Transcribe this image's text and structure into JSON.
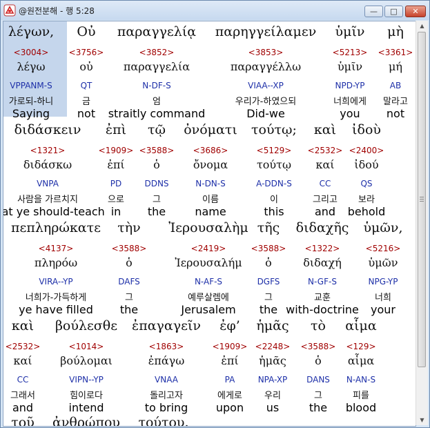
{
  "window": {
    "title": "@원전분해 - 행 5:28",
    "buttons": {
      "minimize": "—",
      "maximize": "□",
      "close": "✕"
    }
  },
  "rows": [
    {
      "words": [
        {
          "greek": "λέγων,",
          "strong": "<3004>",
          "lemma": "λέγω",
          "parse": "VPPANM-S",
          "korean": "가로되-하니",
          "english": "Saying"
        },
        {
          "greek": "Οὐ",
          "strong": "<3756>",
          "lemma": "οὐ",
          "parse": "QT",
          "korean": "금",
          "english": "not"
        },
        {
          "greek": "παραγγελίᾳ",
          "strong": "<3852>",
          "lemma": "παραγγελία",
          "parse": "N-DF-S",
          "korean": "엄",
          "english": "straitly command"
        },
        {
          "greek": "παρηγγείλαμεν",
          "strong": "<3853>",
          "lemma": "παραγγέλλω",
          "parse": "VIAA--XP",
          "korean": "우리가-하였으되",
          "english": "Did-we"
        },
        {
          "greek": "ὑμῖν",
          "strong": "<5213>",
          "lemma": "ὑμῖν",
          "parse": "NPD-YP",
          "korean": "너희에게",
          "english": "you"
        },
        {
          "greek": "μὴ",
          "strong": "<3361>",
          "lemma": "μή",
          "parse": "AB",
          "korean": "말라고",
          "english": "not"
        }
      ]
    },
    {
      "words": [
        {
          "greek": "διδάσκειν",
          "strong": "<1321>",
          "lemma": "διδάσκω",
          "parse": "VNPA",
          "korean": "사람을 가르치지",
          "english": "that ye should-teach"
        },
        {
          "greek": "ἐπὶ",
          "strong": "<1909>",
          "lemma": "ἐπί",
          "parse": "PD",
          "korean": "으로",
          "english": "in"
        },
        {
          "greek": "τῷ",
          "strong": "<3588>",
          "lemma": "ὁ",
          "parse": "DDNS",
          "korean": "그",
          "english": "the"
        },
        {
          "greek": "ὀνόματι",
          "strong": "<3686>",
          "lemma": "ὄνομα",
          "parse": "N-DN-S",
          "korean": "이름",
          "english": "name"
        },
        {
          "greek": "τούτῳ;",
          "strong": "<5129>",
          "lemma": "τούτῳ",
          "parse": "A-DDN-S",
          "korean": "이",
          "english": "this"
        },
        {
          "greek": "καὶ",
          "strong": "<2532>",
          "lemma": "καί",
          "parse": "CC",
          "korean": "그리고",
          "english": "and"
        },
        {
          "greek": "ἰδοὺ",
          "strong": "<2400>",
          "lemma": "ἰδού",
          "parse": "QS",
          "korean": "보라",
          "english": "behold"
        }
      ]
    },
    {
      "words": [
        {
          "greek": "πεπληρώκατε",
          "strong": "<4137>",
          "lemma": "πληρόω",
          "parse": "VIRA--YP",
          "korean": "너희가-가득하게",
          "english": "ye have filled"
        },
        {
          "greek": "τὴν",
          "strong": "<3588>",
          "lemma": "ὁ",
          "parse": "DAFS",
          "korean": "그",
          "english": "the"
        },
        {
          "greek": "Ἰερουσαλὴμ",
          "strong": "<2419>",
          "lemma": "Ἰερουσαλήμ",
          "parse": "N-AF-S",
          "korean": "예루살렘에",
          "english": "Jerusalem"
        },
        {
          "greek": "τῆς",
          "strong": "<3588>",
          "lemma": "ὁ",
          "parse": "DGFS",
          "korean": "그",
          "english": "the"
        },
        {
          "greek": "διδαχῆς",
          "strong": "<1322>",
          "lemma": "διδαχή",
          "parse": "N-GF-S",
          "korean": "교훈",
          "english": "with-doctrine"
        },
        {
          "greek": "ὑμῶν,",
          "strong": "<5216>",
          "lemma": "ὑμῶν",
          "parse": "NPG-YP",
          "korean": "너희",
          "english": "your"
        }
      ]
    },
    {
      "words": [
        {
          "greek": "καὶ",
          "strong": "<2532>",
          "lemma": "καί",
          "parse": "CC",
          "korean": "그래서",
          "english": "and"
        },
        {
          "greek": "βούλεσθε",
          "strong": "<1014>",
          "lemma": "βούλομαι",
          "parse": "VIPN--YP",
          "korean": "힘이로다",
          "english": "intend"
        },
        {
          "greek": "ἐπαγαγεῖν",
          "strong": "<1863>",
          "lemma": "ἐπάγω",
          "parse": "VNAA",
          "korean": "돌리고자",
          "english": "to bring"
        },
        {
          "greek": "ἐφ’",
          "strong": "<1909>",
          "lemma": "ἐπί",
          "parse": "PA",
          "korean": "에게로",
          "english": "upon"
        },
        {
          "greek": "ἡμᾶς",
          "strong": "<2248>",
          "lemma": "ἡμᾶς",
          "parse": "NPA-XP",
          "korean": "우리",
          "english": "us"
        },
        {
          "greek": "τὸ",
          "strong": "<3588>",
          "lemma": "ὁ",
          "parse": "DANS",
          "korean": "그",
          "english": "the"
        },
        {
          "greek": "αἷμα",
          "strong": "<129>",
          "lemma": "αἷμα",
          "parse": "N-AN-S",
          "korean": "피를",
          "english": "blood"
        }
      ]
    },
    {
      "words": [
        {
          "greek": "τοῦ"
        },
        {
          "greek": "ἀνθρώπου"
        },
        {
          "greek": "τούτου."
        }
      ]
    }
  ]
}
